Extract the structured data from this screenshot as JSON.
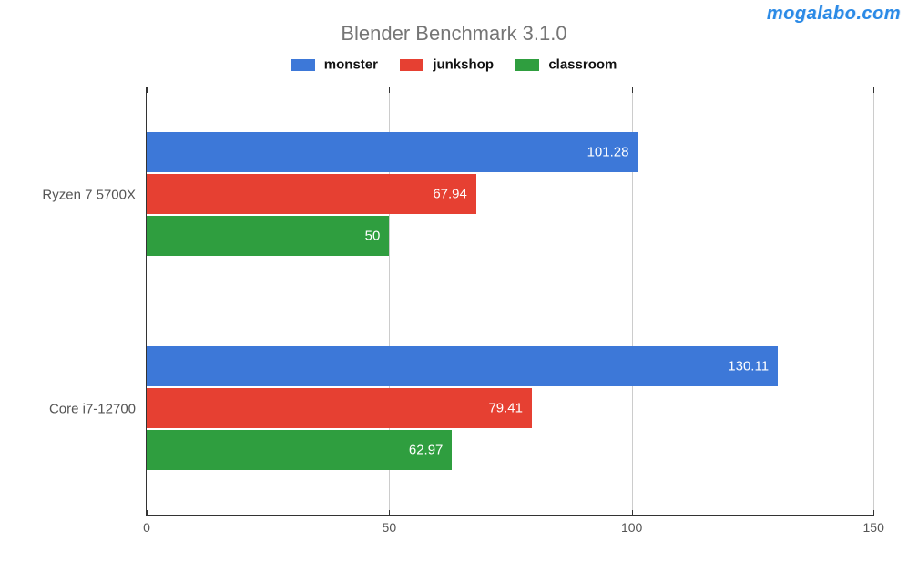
{
  "watermark": "mogalabo.com",
  "chart_data": {
    "type": "bar",
    "orientation": "horizontal",
    "title": "Blender Benchmark 3.1.0",
    "xlabel": "",
    "ylabel": "",
    "xlim": [
      0,
      150
    ],
    "xticks": [
      0,
      50,
      100,
      150
    ],
    "grid": true,
    "legend_position": "top",
    "categories": [
      "Ryzen 7 5700X",
      "Core i7-12700"
    ],
    "series": [
      {
        "name": "monster",
        "color": "#3d78d8",
        "values": [
          101.28,
          130.11
        ]
      },
      {
        "name": "junkshop",
        "color": "#e64032",
        "values": [
          67.94,
          79.41
        ]
      },
      {
        "name": "classroom",
        "color": "#2f9e3f",
        "values": [
          50,
          62.97
        ]
      }
    ]
  }
}
